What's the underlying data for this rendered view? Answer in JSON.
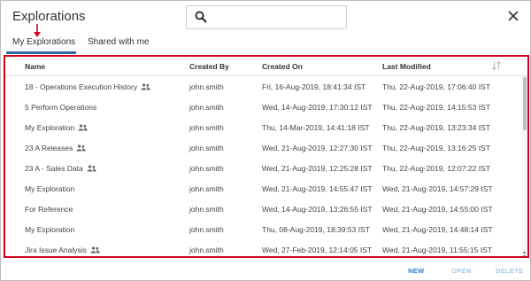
{
  "dialog": {
    "title": "Explorations"
  },
  "search": {
    "value": ""
  },
  "tabs": [
    {
      "label": "My Explorations",
      "active": true
    },
    {
      "label": "Shared with me",
      "active": false
    }
  ],
  "columns": {
    "name": "Name",
    "created_by": "Created By",
    "created_on": "Created On",
    "last_modified": "Last Modified"
  },
  "rows": [
    {
      "name": "18 - Operations Execution History",
      "shared": true,
      "created_by": "john.smith",
      "created_on": "Fri, 16-Aug-2019, 18:41:34 IST",
      "last_modified": "Thu, 22-Aug-2019, 17:06:40 IST"
    },
    {
      "name": "5 Perform Operations",
      "shared": false,
      "created_by": "john.smith",
      "created_on": "Wed, 14-Aug-2019, 17:30:12 IST",
      "last_modified": "Thu, 22-Aug-2019, 14:15:53 IST"
    },
    {
      "name": "My Exploration",
      "shared": true,
      "created_by": "john.smith",
      "created_on": "Thu, 14-Mar-2019, 14:41:18 IST",
      "last_modified": "Thu, 22-Aug-2019, 13:23:34 IST"
    },
    {
      "name": "23 A Releases",
      "shared": true,
      "created_by": "john.smith",
      "created_on": "Wed, 21-Aug-2019, 12:27:30 IST",
      "last_modified": "Thu, 22-Aug-2019, 13:16:25 IST"
    },
    {
      "name": "23 A - Sales Data",
      "shared": true,
      "created_by": "john.smith",
      "created_on": "Wed, 21-Aug-2019, 12:25:28 IST",
      "last_modified": "Thu, 22-Aug-2019, 12:07:22 IST"
    },
    {
      "name": "My Exploration",
      "shared": false,
      "created_by": "john.smith",
      "created_on": "Wed, 21-Aug-2019, 14:55:47 IST",
      "last_modified": "Wed, 21-Aug-2019, 14:57:29 IST"
    },
    {
      "name": "For Reference",
      "shared": false,
      "created_by": "john.smith",
      "created_on": "Wed, 14-Aug-2019, 13:26:55 IST",
      "last_modified": "Wed, 21-Aug-2019, 14:55:00 IST"
    },
    {
      "name": "My Exploration",
      "shared": false,
      "created_by": "john.smith",
      "created_on": "Thu, 08-Aug-2019, 18:39:53 IST",
      "last_modified": "Wed, 21-Aug-2019, 14:48:14 IST"
    },
    {
      "name": "Jira Issue Analysis",
      "shared": true,
      "created_by": "john.smith",
      "created_on": "Wed, 27-Feb-2019, 12:14:05 IST",
      "last_modified": "Wed, 21-Aug-2019, 11:55:15 IST"
    }
  ],
  "footer": {
    "new": "NEW",
    "open": "OPEN",
    "delete": "DELETE"
  },
  "colors": {
    "accent": "#2e6aa1",
    "highlight": "#d0021b",
    "button_active": "#2e7cd6",
    "button_disabled": "#a9c8ea"
  }
}
